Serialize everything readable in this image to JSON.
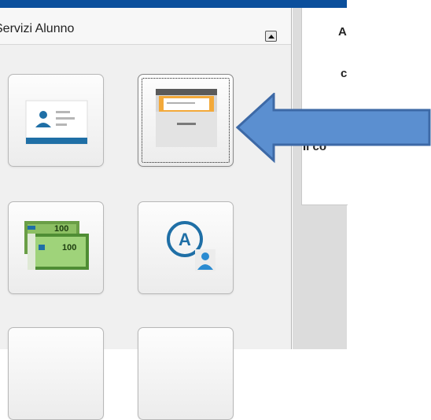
{
  "panel": {
    "title": "Servizi Alunno",
    "tiles": [
      {
        "icon": "student-id-card-icon"
      },
      {
        "icon": "file-drawer-icon",
        "selected": true
      },
      {
        "icon": "banknotes-icon",
        "amount_label": "100"
      },
      {
        "icon": "user-at-badge-icon",
        "letter": "A"
      },
      {
        "icon": "tile-partial-1"
      },
      {
        "icon": "tile-partial-2"
      }
    ]
  },
  "right": {
    "line1": "A",
    "line2": "c",
    "line3": "Il co"
  },
  "colors": {
    "arrow_fill": "#5b8fd0",
    "arrow_stroke": "#3d69a6",
    "accent_blue": "#1f6fa6",
    "top_bar": "#0b4f9c"
  }
}
